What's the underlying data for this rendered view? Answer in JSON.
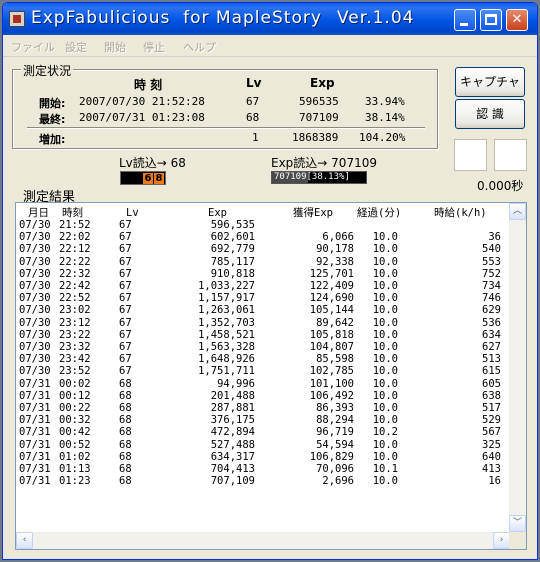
{
  "window": {
    "title": "ExpFabulicious  for MapleStory",
    "version": "Ver.1.04"
  },
  "menu": [
    "ファイル",
    "設定",
    "開始",
    "停止",
    "ヘルプ"
  ],
  "status": {
    "group_title": "測定状況",
    "headers": {
      "time": "時 刻",
      "lv": "Lv",
      "exp": "Exp"
    },
    "start": {
      "label": "開始:",
      "time": "2007/07/30 21:52:28",
      "lv": "67",
      "exp": "596535",
      "pct": "33.94%"
    },
    "latest": {
      "label": "最終:",
      "time": "2007/07/31 01:23:08",
      "lv": "68",
      "exp": "707109",
      "pct": "38.14%"
    },
    "gain": {
      "label": "増加:",
      "lv": "1",
      "exp": "1868389",
      "pct": "104.20%"
    }
  },
  "buttons": {
    "capture": "キャプチャ",
    "recognize": "認 識"
  },
  "timer": "0.000秒",
  "read": {
    "lv_label": "Lv読込→ 68",
    "lv_digits": [
      "6",
      "8"
    ],
    "exp_label": "Exp読込→ 707109",
    "exp_bar_text": "707109[38.13%]",
    "exp_bar_fraction": 0.3813
  },
  "results": {
    "title": "測定結果",
    "columns": [
      "月日",
      "時刻",
      "Lv",
      "Exp",
      "獲得Exp",
      "経過(分)",
      "時給(k/h)"
    ],
    "rows": [
      [
        "07/30",
        "21:52",
        "67",
        "596,535",
        "",
        "",
        ""
      ],
      [
        "07/30",
        "22:02",
        "67",
        "602,601",
        "6,066",
        "10.0",
        "36"
      ],
      [
        "07/30",
        "22:12",
        "67",
        "692,779",
        "90,178",
        "10.0",
        "540"
      ],
      [
        "07/30",
        "22:22",
        "67",
        "785,117",
        "92,338",
        "10.0",
        "553"
      ],
      [
        "07/30",
        "22:32",
        "67",
        "910,818",
        "125,701",
        "10.0",
        "752"
      ],
      [
        "07/30",
        "22:42",
        "67",
        "1,033,227",
        "122,409",
        "10.0",
        "734"
      ],
      [
        "07/30",
        "22:52",
        "67",
        "1,157,917",
        "124,690",
        "10.0",
        "746"
      ],
      [
        "07/30",
        "23:02",
        "67",
        "1,263,061",
        "105,144",
        "10.0",
        "629"
      ],
      [
        "07/30",
        "23:12",
        "67",
        "1,352,703",
        "89,642",
        "10.0",
        "536"
      ],
      [
        "07/30",
        "23:22",
        "67",
        "1,458,521",
        "105,818",
        "10.0",
        "634"
      ],
      [
        "07/30",
        "23:32",
        "67",
        "1,563,328",
        "104,807",
        "10.0",
        "627"
      ],
      [
        "07/30",
        "23:42",
        "67",
        "1,648,926",
        "85,598",
        "10.0",
        "513"
      ],
      [
        "07/30",
        "23:52",
        "67",
        "1,751,711",
        "102,785",
        "10.0",
        "615"
      ],
      [
        "07/31",
        "00:02",
        "68",
        "94,996",
        "101,100",
        "10.0",
        "605"
      ],
      [
        "07/31",
        "00:12",
        "68",
        "201,488",
        "106,492",
        "10.0",
        "638"
      ],
      [
        "07/31",
        "00:22",
        "68",
        "287,881",
        "86,393",
        "10.0",
        "517"
      ],
      [
        "07/31",
        "00:32",
        "68",
        "376,175",
        "88,294",
        "10.0",
        "529"
      ],
      [
        "07/31",
        "00:42",
        "68",
        "472,894",
        "96,719",
        "10.2",
        "567"
      ],
      [
        "07/31",
        "00:52",
        "68",
        "527,488",
        "54,594",
        "10.0",
        "325"
      ],
      [
        "07/31",
        "01:02",
        "68",
        "634,317",
        "106,829",
        "10.0",
        "640"
      ],
      [
        "07/31",
        "01:13",
        "68",
        "704,413",
        "70,096",
        "10.1",
        "413"
      ],
      [
        "07/31",
        "01:23",
        "68",
        "707,109",
        "2,696",
        "10.0",
        "16"
      ]
    ]
  }
}
